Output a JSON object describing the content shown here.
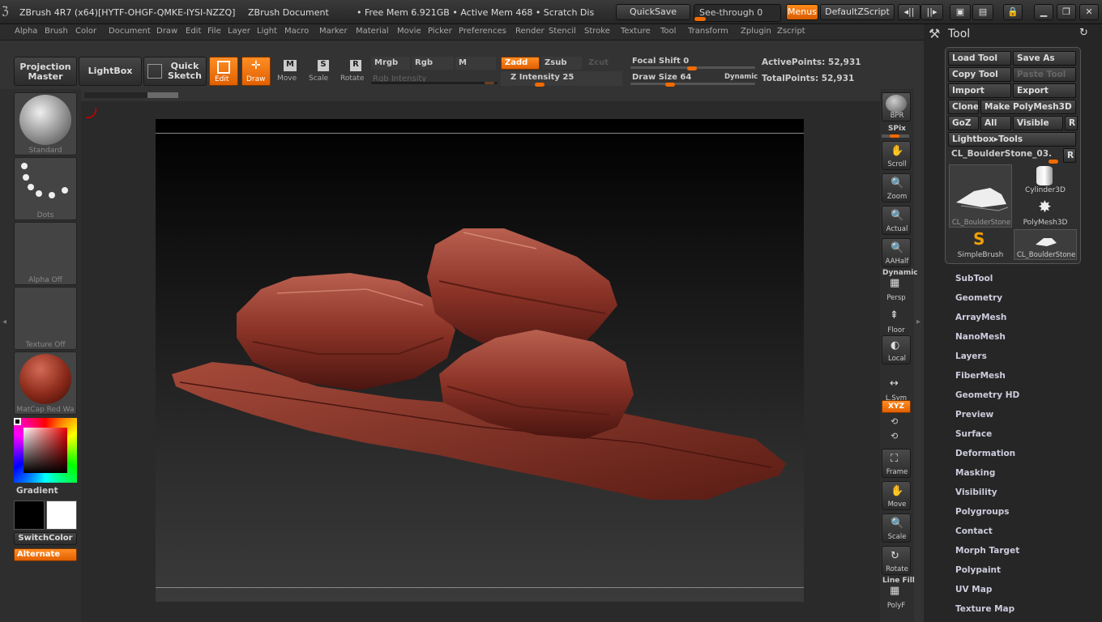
{
  "titlebar": {
    "app": "ZBrush 4R7 (x64)[HYTF-OHGF-QMKE-IYSI-NZZQ]",
    "doc": "ZBrush Document",
    "mem": "• Free Mem 6.921GB • Active Mem 468 • Scratch Dis",
    "quicksave": "QuickSave",
    "seethrough": "See-through 0",
    "menus": "Menus",
    "script": "DefaultZScript"
  },
  "menu": [
    "Alpha",
    "Brush",
    "Color",
    "Document",
    "Draw",
    "Edit",
    "File",
    "Layer",
    "Light",
    "Macro",
    "Marker",
    "Material",
    "Movie",
    "Picker",
    "Preferences",
    "Render",
    "Stencil",
    "Stroke",
    "Texture",
    "Tool",
    "Transform",
    "Zplugin",
    "Zscript"
  ],
  "toolbar": {
    "projection": "Projection Master",
    "lightbox": "LightBox",
    "quicksketch": "Quick Sketch",
    "edit": "Edit",
    "draw": "Draw",
    "move": "Move",
    "scale": "Scale",
    "rotate": "Rotate",
    "mrgb": "Mrgb",
    "rgb": "Rgb",
    "m": "M",
    "rgbint": "Rgb Intensity",
    "zadd": "Zadd",
    "zsub": "Zsub",
    "zcut": "Zcut",
    "zint": "Z Intensity 25",
    "focal": "Focal Shift 0",
    "drawsize": "Draw Size 64",
    "dynamic": "Dynamic",
    "active": "ActivePoints: 52,931",
    "total": "TotalPoints: 52,931",
    "zint_value": 25,
    "focal_value": 0,
    "drawsize_value": 64
  },
  "left": {
    "standard": "Standard",
    "dots": "Dots",
    "alpha": "Alpha Off",
    "texture": "Texture Off",
    "matcap": "MatCap Red Wa",
    "gradient": "Gradient",
    "switchcolor": "SwitchColor",
    "alternate": "Alternate"
  },
  "right": [
    "BPR",
    "SPix",
    "Scroll",
    "Zoom",
    "Actual",
    "AAHalf",
    "Dynamic",
    "Persp",
    "Floor",
    "Local",
    "L.Sym",
    "XYZ",
    "Frame",
    "Move",
    "Scale",
    "Rotate",
    "Line Fill",
    "PolyF"
  ],
  "tool": {
    "title": "Tool",
    "load": "Load Tool",
    "saveas": "Save As",
    "copy": "Copy Tool",
    "paste": "Paste Tool",
    "import": "Import",
    "export": "Export",
    "clone": "Clone",
    "makepoly": "Make PolyMesh3D",
    "goz": "GoZ",
    "all": "All",
    "visible": "Visible",
    "r": "R",
    "lightbox": "Lightbox▸Tools",
    "current": "CL_BoulderStone_03.",
    "items": [
      "CL_BoulderStone",
      "Cylinder3D",
      "PolyMesh3D",
      "SimpleBrush",
      "CL_BoulderStone"
    ],
    "sections": [
      "SubTool",
      "Geometry",
      "ArrayMesh",
      "NanoMesh",
      "Layers",
      "FiberMesh",
      "Geometry HD",
      "Preview",
      "Surface",
      "Deformation",
      "Masking",
      "Visibility",
      "Polygroups",
      "Contact",
      "Morph Target",
      "Polypaint",
      "UV Map",
      "Texture Map"
    ]
  }
}
